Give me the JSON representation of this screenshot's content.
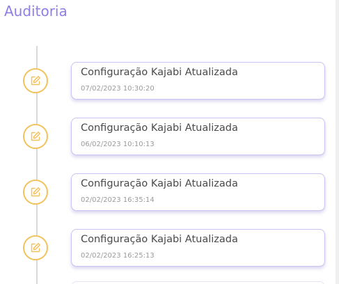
{
  "header": {
    "title": "Auditoria"
  },
  "colors": {
    "accent": "#8f7ee6",
    "icon_ring": "#f4c25b",
    "card_border": "#c9c2f2",
    "timeline": "#d9d9d9"
  },
  "timeline": {
    "entries": [
      {
        "title": "Configuração Kajabi Atualizada",
        "date": "07/02/2023 10:30:20",
        "icon": "edit-icon"
      },
      {
        "title": "Configuração Kajabi Atualizada",
        "date": "06/02/2023 10:10:13",
        "icon": "edit-icon"
      },
      {
        "title": "Configuração Kajabi Atualizada",
        "date": "02/02/2023 16:35:14",
        "icon": "edit-icon"
      },
      {
        "title": "Configuração Kajabi Atualizada",
        "date": "02/02/2023 16:25:13",
        "icon": "edit-icon"
      }
    ]
  }
}
